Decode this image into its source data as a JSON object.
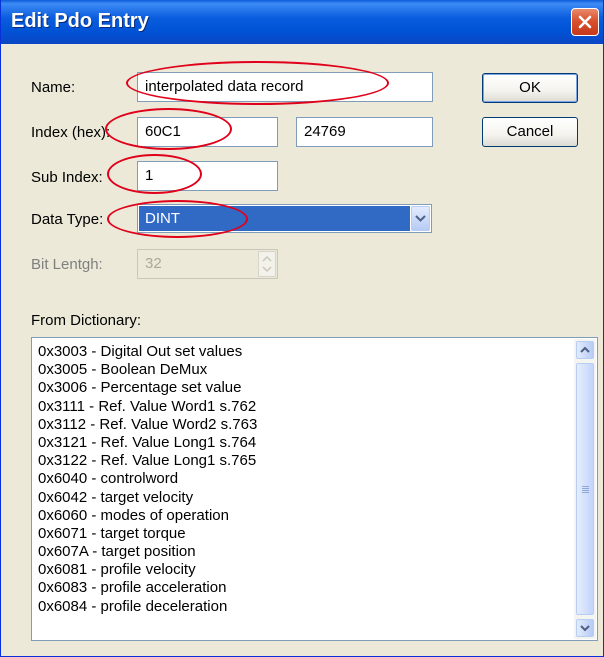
{
  "window": {
    "title": "Edit Pdo Entry"
  },
  "fields": {
    "name": {
      "label": "Name:",
      "value": "interpolated data record"
    },
    "index": {
      "label": "Index (hex):",
      "hex_value": "60C1",
      "dec_value": "24769"
    },
    "sub_index": {
      "label": "Sub Index:",
      "value": "1"
    },
    "data_type": {
      "label": "Data Type:",
      "value": "DINT"
    },
    "bit_length": {
      "label": "Bit Lentgh:",
      "value": "32"
    }
  },
  "buttons": {
    "ok": "OK",
    "cancel": "Cancel"
  },
  "dictionary": {
    "label": "From Dictionary:",
    "items": [
      "0x3003 - Digital Out set values",
      "0x3005 - Boolean DeMux",
      "0x3006 - Percentage set value",
      "0x3111 - Ref. Value Word1 s.762",
      "0x3112 - Ref. Value Word2 s.763",
      "0x3121 - Ref. Value Long1 s.764",
      "0x3122 - Ref. Value Long1 s.765",
      "0x6040 - controlword",
      "0x6042 - target velocity",
      "0x6060 - modes of operation",
      "0x6071 - target torque",
      "0x607A - target position",
      "0x6081 - profile velocity",
      "0x6083 - profile acceleration",
      "0x6084 - profile deceleration"
    ]
  },
  "icons": {
    "close": "close-x-icon",
    "dropdown": "chevron-down-icon",
    "spin": "spin-arrows-icon",
    "scroll_up": "scroll-up-icon",
    "scroll_down": "scroll-down-icon"
  },
  "colors": {
    "titlebar": "#0153d6",
    "dialog_bg": "#ece9d8",
    "selection": "#316ac5",
    "annotation": "#e0001a",
    "close_button": "#d9522f"
  }
}
